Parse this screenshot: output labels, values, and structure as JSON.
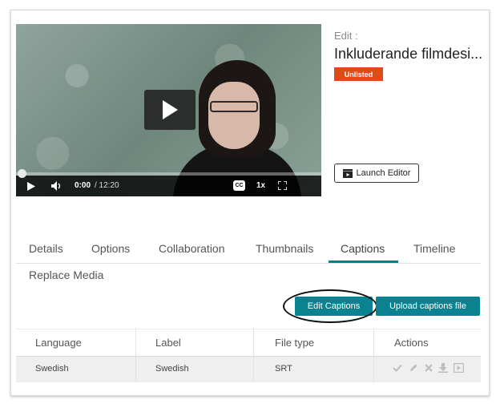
{
  "player": {
    "time_current": "0:00",
    "time_total": "/ 12:20",
    "speed": "1x",
    "progress": 0
  },
  "media": {
    "edit_label": "Edit :",
    "title": "Inkluderande filmdesi...",
    "status_badge": "Unlisted",
    "launch_editor_label": "Launch Editor"
  },
  "tabs": [
    {
      "label": "Details"
    },
    {
      "label": "Options"
    },
    {
      "label": "Collaboration"
    },
    {
      "label": "Thumbnails"
    },
    {
      "label": "Captions",
      "active": true
    },
    {
      "label": "Timeline"
    },
    {
      "label": "Replace Media"
    }
  ],
  "captions": {
    "edit_button": "Edit Captions",
    "upload_button": "Upload captions file",
    "columns": [
      "Language",
      "Label",
      "File type",
      "Actions"
    ],
    "rows": [
      {
        "language": "Swedish",
        "label": "Swedish",
        "file_type": "SRT"
      }
    ],
    "action_icons": [
      "check-icon",
      "pencil-icon",
      "delete-icon",
      "download-icon",
      "preview-icon"
    ]
  },
  "colors": {
    "accent": "#0a8290",
    "badge": "#dd4b17"
  }
}
